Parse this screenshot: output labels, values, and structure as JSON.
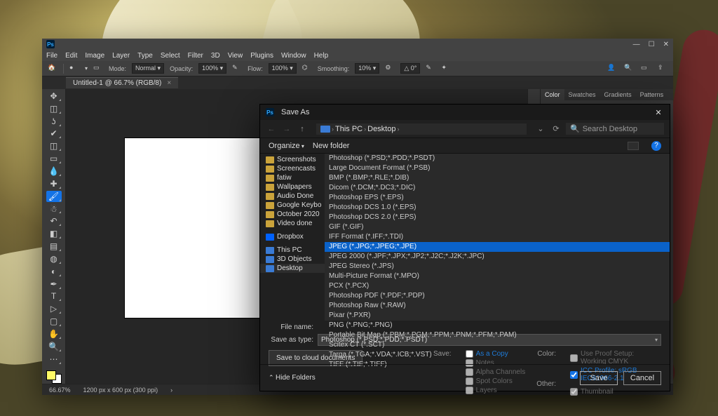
{
  "ps": {
    "menus": [
      "File",
      "Edit",
      "Image",
      "Layer",
      "Type",
      "Select",
      "Filter",
      "3D",
      "View",
      "Plugins",
      "Window",
      "Help"
    ],
    "options": {
      "mode_label": "Mode:",
      "mode_value": "Normal",
      "opacity_label": "Opacity:",
      "opacity_value": "100%",
      "flow_label": "Flow:",
      "flow_value": "100%",
      "smoothing_label": "Smoothing:",
      "smoothing_value": "10%"
    },
    "doc_tab": "Untitled-1 @ 66.7% (RGB/8)",
    "panels_tabs": [
      "Color",
      "Swatches",
      "Gradients",
      "Patterns"
    ],
    "status_zoom": "66.67%",
    "status_doc": "1200 px x 600 px (300 ppi)"
  },
  "dlg": {
    "title": "Save As",
    "breadcrumb": [
      "This PC",
      "Desktop"
    ],
    "search_placeholder": "Search Desktop",
    "organize": "Organize",
    "new_folder": "New folder",
    "tree": [
      {
        "label": "Screenshots",
        "cls": ""
      },
      {
        "label": "Screencasts",
        "cls": ""
      },
      {
        "label": "fatiw",
        "cls": ""
      },
      {
        "label": "Wallpapers",
        "cls": ""
      },
      {
        "label": "Audio Done",
        "cls": ""
      },
      {
        "label": "Google Keybo",
        "cls": ""
      },
      {
        "label": "October 2020",
        "cls": ""
      },
      {
        "label": "Video done",
        "cls": ""
      },
      {
        "label": "Dropbox",
        "cls": "sp db"
      },
      {
        "label": "This PC",
        "cls": "sp blue"
      },
      {
        "label": "3D Objects",
        "cls": "blue"
      },
      {
        "label": "Desktop",
        "cls": "blue sel"
      }
    ],
    "formats": [
      "Photoshop (*.PSD;*.PDD;*.PSDT)",
      "Large Document Format (*.PSB)",
      "BMP (*.BMP;*.RLE;*.DIB)",
      "Dicom (*.DCM;*.DC3;*.DIC)",
      "Photoshop EPS (*.EPS)",
      "Photoshop DCS 1.0 (*.EPS)",
      "Photoshop DCS 2.0 (*.EPS)",
      "GIF (*.GIF)",
      "IFF Format (*.IFF;*.TDI)",
      "JPEG (*.JPG;*.JPEG;*.JPE)",
      "JPEG 2000 (*.JPF;*.JPX;*.JP2;*.J2C;*.J2K;*.JPC)",
      "JPEG Stereo (*.JPS)",
      "Multi-Picture Format (*.MPO)",
      "PCX (*.PCX)",
      "Photoshop PDF (*.PDF;*.PDP)",
      "Photoshop Raw (*.RAW)",
      "Pixar (*.PXR)",
      "PNG (*.PNG;*.PNG)",
      "Portable Bit Map (*.PBM;*.PGM;*.PPM;*.PNM;*.PFM;*.PAM)",
      "Scitex CT (*.SCT)",
      "Targa (*.TGA;*.VDA;*.ICB;*.VST)",
      "TIFF (*.TIF;*.TIFF)"
    ],
    "formats_selected_index": 9,
    "filename_label": "File name:",
    "saveas_label": "Save as type:",
    "saveas_value": "Photoshop (*.PSD;*.PDD;*.PSDT)",
    "cloud_btn": "Save to cloud documents",
    "save_section": "Save:",
    "save_options": [
      "As a Copy",
      "Notes",
      "Alpha Channels",
      "Spot Colors",
      "Layers"
    ],
    "color_section": "Color:",
    "color_opt1": "Use Proof Setup: Working CMYK",
    "color_opt2": "ICC Profile: sRGB IEC61966-2.1",
    "other_section": "Other:",
    "other_opt": "Thumbnail",
    "hide_folders": "Hide Folders",
    "save_btn": "Save",
    "cancel_btn": "Cancel"
  }
}
